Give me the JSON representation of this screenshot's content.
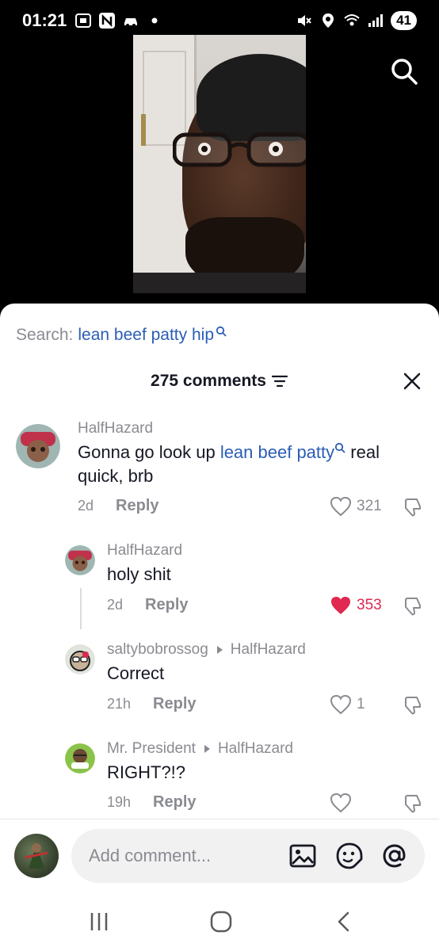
{
  "status_bar": {
    "time": "01:21",
    "battery": "41",
    "icons": [
      "screenshot-icon",
      "n-app-icon",
      "car-icon",
      "dot-icon",
      "mute-icon",
      "location-icon",
      "wifi-icon",
      "signal-icon"
    ]
  },
  "search": {
    "prefix": "Search:",
    "term": "lean beef patty hip"
  },
  "header": {
    "comments_count": "275 comments"
  },
  "comments": [
    {
      "username": "HalfHazard",
      "text_before": "Gonna go look up ",
      "link": "lean beef patty",
      "text_after": " real quick, brb",
      "time": "2d",
      "reply": "Reply",
      "likes": "321",
      "liked": false
    },
    {
      "username": "HalfHazard",
      "text": "holy shit",
      "time": "2d",
      "reply": "Reply",
      "likes": "353",
      "liked": true
    },
    {
      "username": "saltybobrossog",
      "reply_to": "HalfHazard",
      "text": "Correct",
      "time": "21h",
      "reply": "Reply",
      "likes": "1",
      "liked": false
    },
    {
      "username": "Mr. President",
      "reply_to": "HalfHazard",
      "text": "RIGHT?!?",
      "time": "19h",
      "reply": "Reply",
      "likes": "",
      "liked": false
    }
  ],
  "input": {
    "placeholder": "Add comment..."
  },
  "colors": {
    "link": "#2b5db5",
    "liked": "#e02850",
    "muted": "#8a8b91"
  }
}
